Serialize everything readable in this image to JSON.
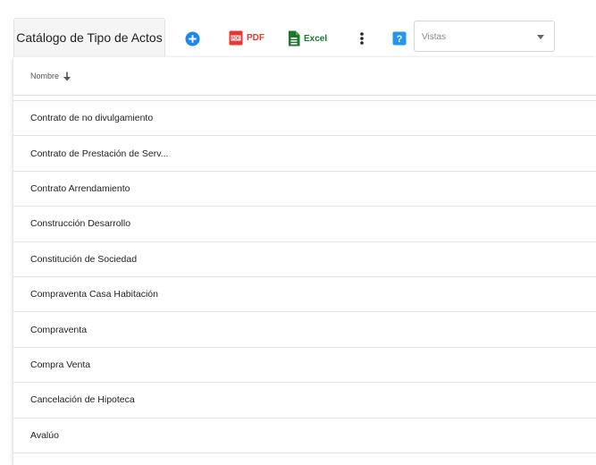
{
  "toolbar": {
    "title": "Catálogo de Tipo de Actos",
    "pdf_label": "PDF",
    "excel_label": "Excel",
    "views_placeholder": "Vistas"
  },
  "table": {
    "column_header": "Nombre",
    "rows": [
      "Contrato de no divulgamiento",
      "Contrato de Prestación de Serv...",
      "Contrato Arrendamiento",
      "Construcción Desarrollo",
      "Constitución de Sociedad",
      "Compraventa Casa Habitación",
      "Compraventa",
      "Compra Venta",
      "Cancelación de Hipoteca",
      "Avalúo"
    ]
  }
}
